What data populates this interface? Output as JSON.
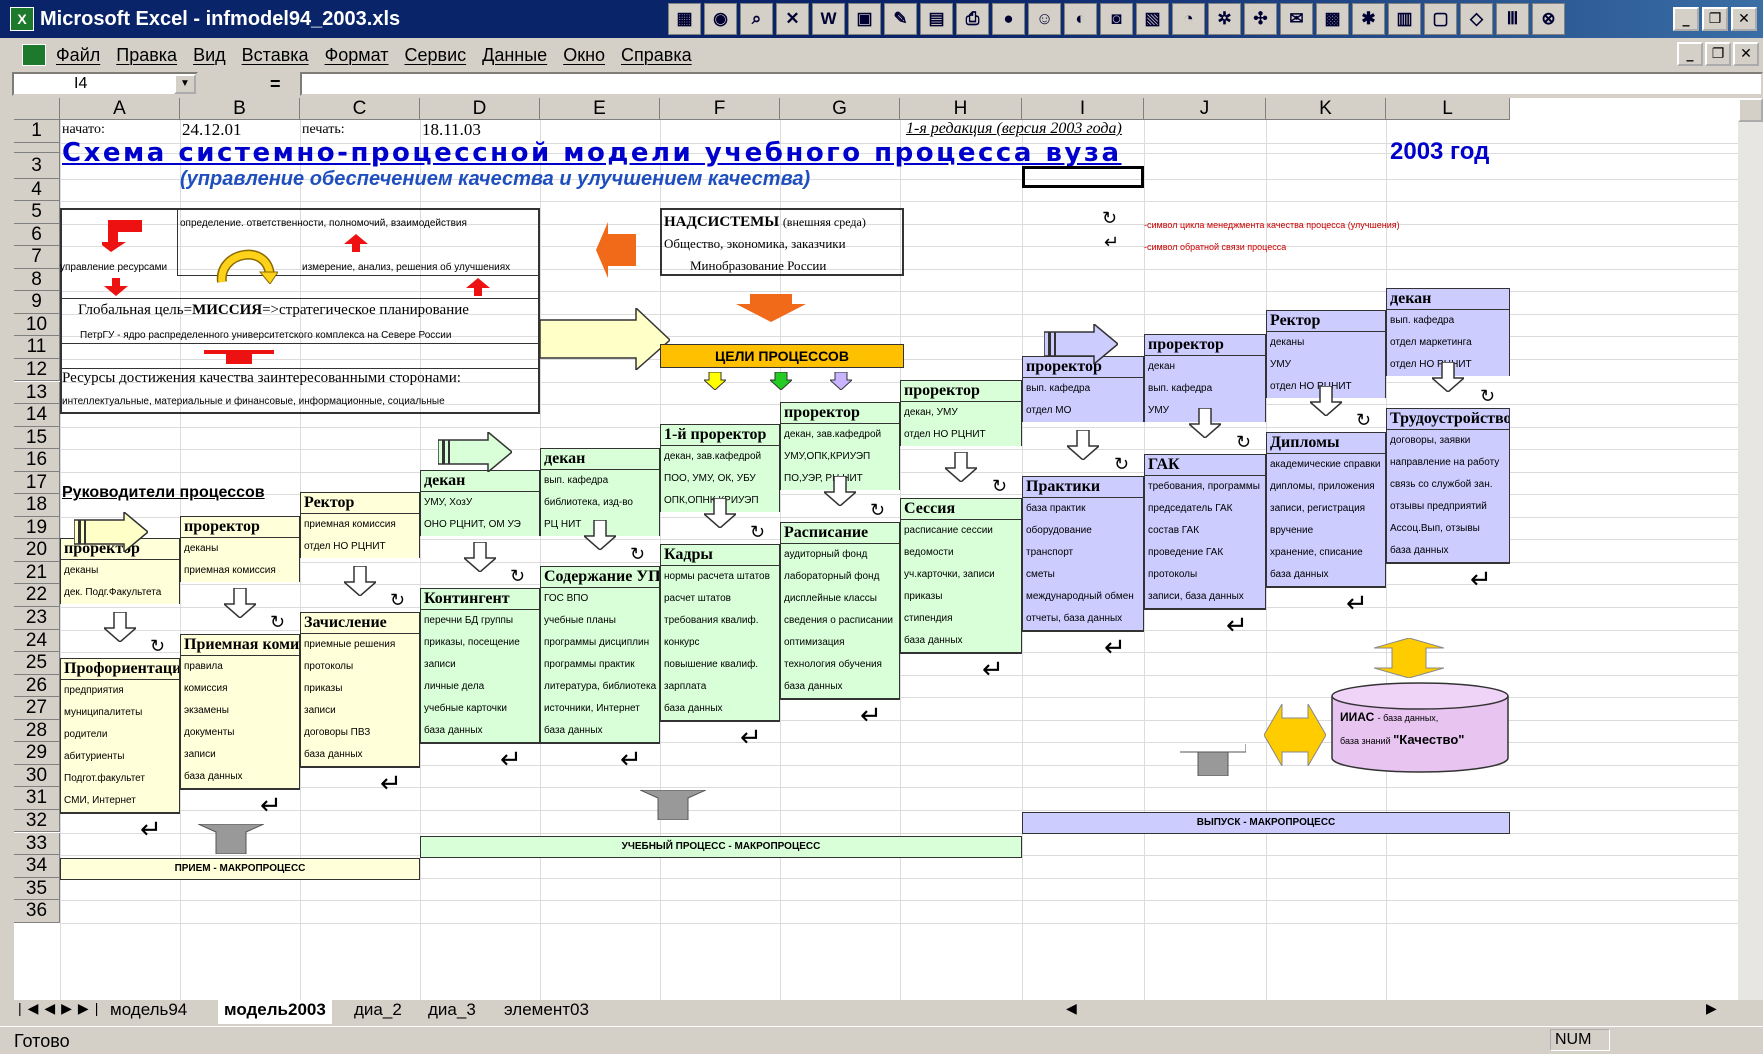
{
  "window": {
    "title": "Microsoft Excel - infmodel94_2003.xls"
  },
  "menu": [
    "Файл",
    "Правка",
    "Вид",
    "Вставка",
    "Формат",
    "Сервис",
    "Данные",
    "Окно",
    "Справка"
  ],
  "namebox": "I4",
  "eq": "=",
  "columns": [
    "A",
    "B",
    "C",
    "D",
    "E",
    "F",
    "G",
    "H",
    "I",
    "J",
    "K",
    "L"
  ],
  "rows": [
    "1",
    "",
    "3",
    "4",
    "5",
    "6",
    "7",
    "8",
    "9",
    "10",
    "11",
    "12",
    "13",
    "14",
    "15",
    "16",
    "17",
    "18",
    "19",
    "20",
    "21",
    "22",
    "23",
    "24",
    "25",
    "26",
    "27",
    "28",
    "29",
    "30",
    "31",
    "32",
    "33",
    "34",
    "35",
    "36"
  ],
  "row1": {
    "a": "начато:",
    "b": "24.12.01",
    "c": "печать:",
    "d": "18.11.03",
    "h": "1-я редакция (версия 2003 года)"
  },
  "title": "Схема системно-процессной модели учебного процесса вуза",
  "year": "2003 год",
  "subtitle": "(управление обеспечением качества и улучшением качества)",
  "topbox": {
    "r6": "определение. ответственности, полномочий, взаимодействия",
    "r8a": "управление ресурсами",
    "r8b": "измерение, анализ, решения об улучшениях",
    "r10a": "Глобальная цель=",
    "r10b": "МИССИЯ",
    "r10c": "=>стратегическое планирование",
    "r11": "ПетрГУ - ядро распределенного университетского комплекса на Севере России",
    "r13": "Ресурсы достижения качества заинтересованными сторонами:",
    "r14": "интеллектуальные, материальные и финансовые, информационные, социальные"
  },
  "nadsys": {
    "l1": "НАДСИСТЕМЫ",
    "l1b": "(внешняя среда)",
    "l2": "Общество, экономика, заказчики",
    "l3": "Минобразование России"
  },
  "legend": {
    "l1": "-символ цикла менеджмента качества процесса (улучшения)",
    "l2": "-символ обратной связи процесса"
  },
  "goals": "ЦЕЛИ ПРОЦЕССОВ",
  "leaders": "Руководители процессов",
  "blocks": [
    {
      "id": "a",
      "head": "проректор",
      "lines": [
        "деканы",
        "дек. Подг.Факультета"
      ]
    },
    {
      "id": "b",
      "head": "проректор",
      "lines": [
        "деканы",
        "приемная комиссия"
      ]
    },
    {
      "id": "c",
      "head": "Ректор",
      "lines": [
        "приемная комиссия",
        "отдел НО РЦНИТ"
      ]
    },
    {
      "id": "d",
      "head": "декан",
      "lines": [
        "УМУ, ХозУ",
        "ОНО РЦНИТ, ОМ УЭ"
      ]
    },
    {
      "id": "e",
      "head": "декан",
      "lines": [
        "вып. кафедра",
        "библиотека, изд-во",
        "РЦ НИТ"
      ]
    },
    {
      "id": "f",
      "head": "1-й проректор",
      "lines": [
        "декан, зав.кафедрой",
        "ПОО, УМУ, ОК, УБУ",
        "ОПК,ОПНК,КРИУЭП"
      ]
    },
    {
      "id": "g",
      "head": "проректор",
      "lines": [
        "декан, зав.кафедрой",
        "УМУ,ОПК,КРИУЭП",
        "ПО,УЭР, РЦ НИТ"
      ]
    },
    {
      "id": "h",
      "head": "проректор",
      "lines": [
        "декан, УМУ",
        "отдел НО РЦНИТ"
      ]
    },
    {
      "id": "i",
      "head": "проректор",
      "lines": [
        "вып. кафедра",
        "отдел МО"
      ]
    },
    {
      "id": "j",
      "head": "проректор",
      "lines": [
        "декан",
        "вып. кафедра",
        "УМУ"
      ]
    },
    {
      "id": "k",
      "head": "Ректор",
      "lines": [
        "деканы",
        "УМУ",
        "отдел НО РЦНИТ"
      ]
    },
    {
      "id": "l",
      "head": "декан",
      "lines": [
        "вып. кафедра",
        "отдел маркетинга",
        "отдел НО РЦНИТ"
      ]
    }
  ],
  "processes": [
    {
      "id": "a",
      "head": "Профориентация",
      "lines": [
        "предприятия",
        "муниципалитеты",
        "родители",
        "абитуриенты",
        "Подгот.факультет",
        "СМИ, Интернет"
      ]
    },
    {
      "id": "b",
      "head": "Приемная комиссия",
      "lines": [
        "правила",
        "комиссия",
        "экзамены",
        "документы",
        "записи",
        "база данных"
      ]
    },
    {
      "id": "c",
      "head": "Зачисление",
      "lines": [
        "приемные решения",
        "протоколы",
        "приказы",
        "записи",
        "договоры ПВЗ",
        "база данных"
      ]
    },
    {
      "id": "d",
      "head": "Контингент",
      "lines": [
        "перечни БД группы",
        "приказы, посещение",
        "записи",
        "личные дела",
        "учебные карточки",
        "база данных"
      ]
    },
    {
      "id": "e",
      "head": "Содержание УП",
      "lines": [
        "ГОС ВПО",
        "учебные планы",
        "программы дисциплин",
        "программы практик",
        "литература, библиотека",
        "источники, Интернет",
        "база данных"
      ]
    },
    {
      "id": "f",
      "head": "Кадры",
      "lines": [
        "нормы расчета штатов",
        "расчет штатов",
        "требования квалиф.",
        "конкурс",
        "повышение квалиф.",
        "зарплата",
        "база данных"
      ]
    },
    {
      "id": "g",
      "head": "Расписание",
      "lines": [
        "аудиторный фонд",
        "лабораторный фонд",
        "дисплейные классы",
        "сведения о расписании",
        "оптимизация",
        "технология обучения",
        "база данных"
      ]
    },
    {
      "id": "h",
      "head": "Сессия",
      "lines": [
        "расписание сессии",
        "ведомости",
        "уч.карточки, записи",
        "приказы",
        "стипендия",
        "база данных"
      ]
    },
    {
      "id": "i",
      "head": "Практики",
      "lines": [
        "база практик",
        "оборудование",
        "транспорт",
        "сметы",
        "международный обмен",
        "отчеты, база данных"
      ]
    },
    {
      "id": "j",
      "head": "ГАК",
      "lines": [
        "требования, программы",
        "председатель ГАК",
        "состав ГАК",
        "проведение ГАК",
        "протоколы",
        "записи, база данных"
      ]
    },
    {
      "id": "k",
      "head": "Дипломы",
      "lines": [
        "академические справки",
        "дипломы, приложения",
        "записи, регистрация",
        "вручение",
        "хранение, списание",
        "база данных"
      ]
    },
    {
      "id": "l",
      "head": "Трудоустройство",
      "lines": [
        "договоры, заявки",
        "направление на работу",
        "связь со службой зан.",
        "отзывы предприятий",
        "Ассоц.Вып, отзывы",
        "база данных"
      ]
    }
  ],
  "macros": {
    "priem": "ПРИЕМ - МАКРОПРОЦЕСС",
    "ucheb": "УЧЕБНЫЙ ПРОЦЕСС - МАКРОПРОЦЕСС",
    "vypusk": "ВЫПУСК - МАКРОПРОЦЕСС"
  },
  "iias": {
    "bold": "ИИАС",
    "l1": "- база данных,",
    "l2": "база знаний",
    "q": "\"Качество\""
  },
  "tabs": [
    "модель94",
    "модель2003",
    "диа_2",
    "диа_3",
    "элемент03"
  ],
  "status": "Готово",
  "num": "NUM",
  "colors": {
    "yellow": "#ffffd9",
    "green": "#d9ffd9",
    "purple": "#ccccff",
    "goal": "#ffc000",
    "title_blue": "#0000cc"
  }
}
